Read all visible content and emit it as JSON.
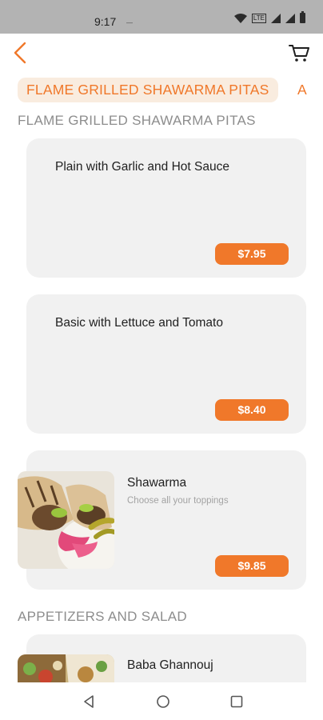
{
  "status_bar": {
    "time": "9:17",
    "sim_indicator": "—",
    "network_type": "LTE",
    "icons": [
      "wifi-icon",
      "lte-icon",
      "signal-icon",
      "signal-icon",
      "battery-icon"
    ]
  },
  "app_bar": {
    "back_icon": "chevron-left-icon",
    "cart_icon": "cart-icon",
    "accent_color": "#f0782a"
  },
  "category_tabs": [
    {
      "label": "FLAME GRILLED SHAWARMA PITAS",
      "active": true
    },
    {
      "label": "A",
      "active": false
    }
  ],
  "sections": [
    {
      "title": "FLAME GRILLED SHAWARMA PITAS",
      "items": [
        {
          "name": "Plain with Garlic and Hot Sauce",
          "description": "",
          "price": "$7.95",
          "has_image": false
        },
        {
          "name": "Basic with Lettuce and Tomato",
          "description": "",
          "price": "$8.40",
          "has_image": false
        },
        {
          "name": "Shawarma",
          "description": "Choose all your toppings",
          "price": "$9.85",
          "has_image": true
        }
      ]
    },
    {
      "title": "APPETIZERS AND SALAD",
      "items": [
        {
          "name": "Baba Ghannouj",
          "description": "",
          "price": "",
          "has_image": true
        }
      ]
    }
  ],
  "nav_bar": {
    "buttons": [
      "back-triangle-icon",
      "home-circle-icon",
      "recents-square-icon"
    ]
  }
}
